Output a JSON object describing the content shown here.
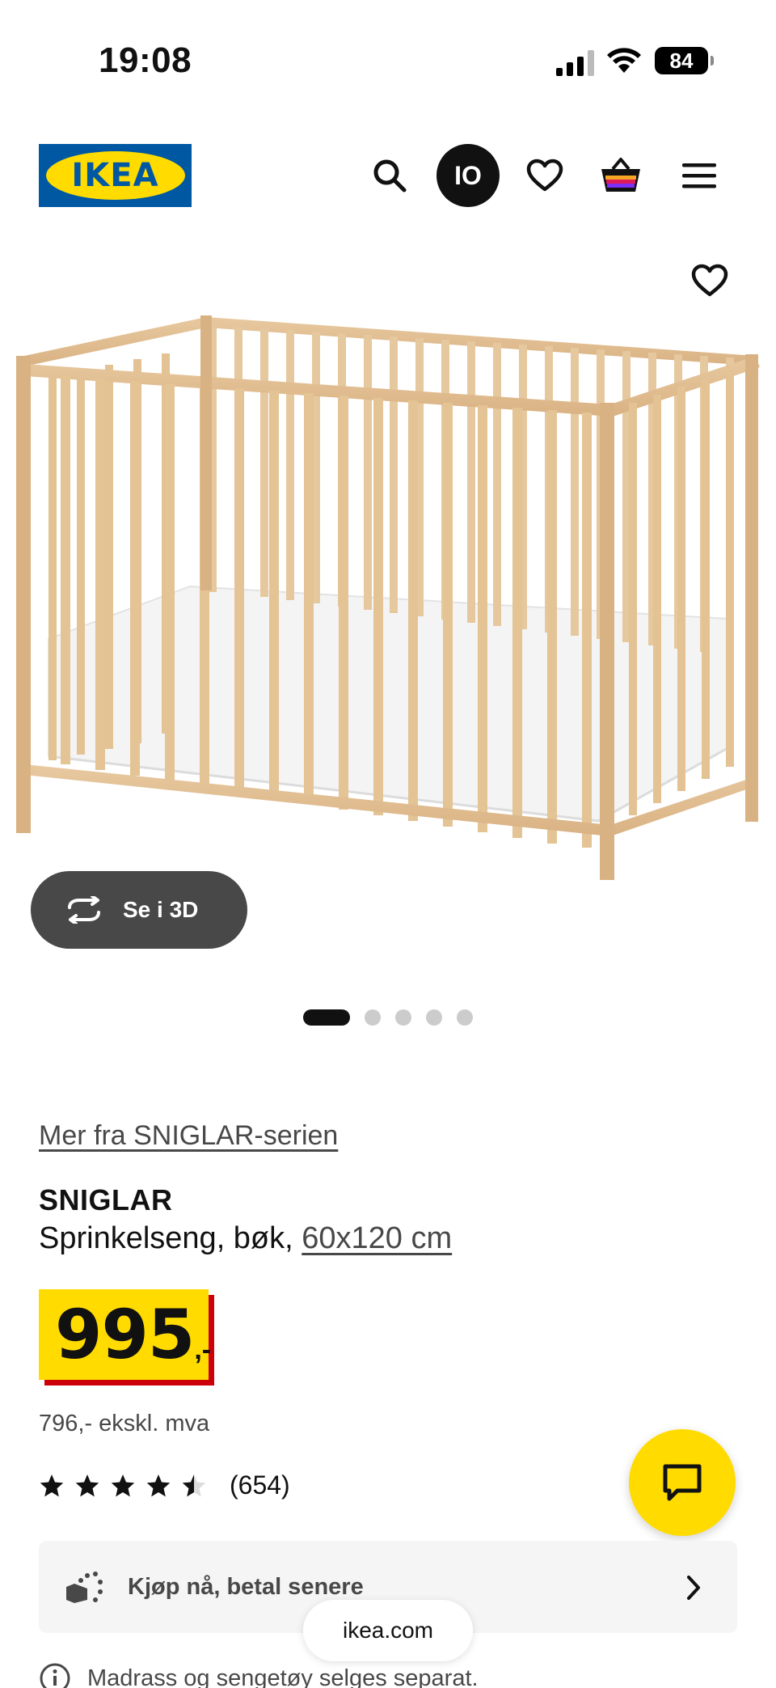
{
  "status_bar": {
    "time": "19:08",
    "battery": "84"
  },
  "header": {
    "logo_text": "IKEA",
    "avatar_initials": "IO",
    "icons": [
      "search-icon",
      "heart-icon",
      "shopping-bag-icon",
      "menu-icon"
    ]
  },
  "gallery": {
    "view_3d_label": "Se i 3D",
    "slide_count": 5,
    "active_slide": 1
  },
  "product": {
    "series_link": "Mer fra SNIGLAR-serien",
    "name": "SNIGLAR",
    "description": "Sprinkelseng, bøk, ",
    "size": "60x120 cm",
    "price_integer": "995",
    "price_decimal": ",-",
    "price_ex_vat": "796,- ekskl. mva",
    "rating": 4.5,
    "rating_count": "(654)"
  },
  "pay_later": {
    "label": "Kjøp nå, betal senere"
  },
  "browser": {
    "url": "ikea.com"
  },
  "notice": {
    "text": "Madrass og sengetøy selges separat."
  },
  "colors": {
    "ikea_blue": "#0058a3",
    "ikea_yellow": "#ffdb00",
    "price_shadow_red": "#cc0008",
    "button_dark": "#484848"
  }
}
